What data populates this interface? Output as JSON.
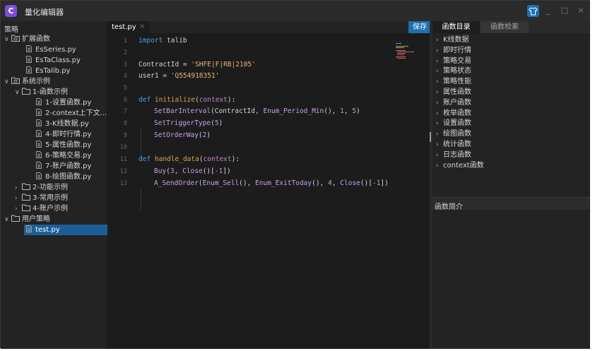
{
  "app": {
    "title": "量化编辑器",
    "logo_glyph": "C"
  },
  "strategy_panel": {
    "header": "策略",
    "tree": [
      {
        "label": "扩展函数",
        "kind": "folder-special",
        "expanded": true
      },
      {
        "label": "EsSeries.py",
        "kind": "file"
      },
      {
        "label": "EsTaClass.py",
        "kind": "file"
      },
      {
        "label": "EsTalib.py",
        "kind": "file"
      },
      {
        "label": "系统示例",
        "kind": "folder-special",
        "expanded": true
      },
      {
        "label": "1-函数示例",
        "kind": "folder",
        "expanded": true
      },
      {
        "label": "1-设置函数.py",
        "kind": "file"
      },
      {
        "label": "2-context上下文...",
        "kind": "file"
      },
      {
        "label": "3-K线数据.py",
        "kind": "file"
      },
      {
        "label": "4-即时行情.py",
        "kind": "file"
      },
      {
        "label": "5-属性函数.py",
        "kind": "file"
      },
      {
        "label": "6-策略交易.py",
        "kind": "file"
      },
      {
        "label": "7-账户函数.py",
        "kind": "file"
      },
      {
        "label": "8-绘图函数.py",
        "kind": "file"
      },
      {
        "label": "2-功能示例",
        "kind": "folder",
        "expanded": false
      },
      {
        "label": "3-常用示例",
        "kind": "folder",
        "expanded": false
      },
      {
        "label": "4-账户示例",
        "kind": "folder",
        "expanded": false
      },
      {
        "label": "用户策略",
        "kind": "folder",
        "expanded": true
      },
      {
        "label": "test.py",
        "kind": "file",
        "selected": true
      }
    ]
  },
  "editor": {
    "tab_label": "test.py",
    "tab_close": "×",
    "save_label": "保存",
    "line_numbers": [
      "1",
      "2",
      "3",
      "4",
      "5",
      "6",
      "7",
      "8",
      "9",
      "10",
      "11",
      "12",
      "13"
    ],
    "code": {
      "l1_kw": "import",
      "l1_rest": " talib",
      "l3_name": "ContractId = ",
      "l3_str": "'SHFE|F|RB|2105'",
      "l4_name": "user1 = ",
      "l4_str": "'Q554918351'",
      "l6_kw": "def",
      "l6_fn": "initialize",
      "l6_open": "(",
      "l6_param": "context",
      "l6_close": "):",
      "l7_fn": "SetBarInterval",
      "l7_a": "(ContractId, ",
      "l7_b": "Enum_Period_Min",
      "l7_c": "(), ",
      "l7_n1": "1",
      "l7_d": ", ",
      "l7_n2": "5",
      "l7_e": ")",
      "l8_fn": "SetTriggerType",
      "l8_a": "(",
      "l8_n": "5",
      "l8_b": ")",
      "l9_fn": "SetOrderWay",
      "l9_a": "(",
      "l9_n": "2",
      "l9_b": ")",
      "l11_kw": "def",
      "l11_fn": "handle_data",
      "l11_open": "(",
      "l11_param": "context",
      "l11_close": "):",
      "l12_fn": "Buy",
      "l12_a": "(",
      "l12_n": "3",
      "l12_b": ", ",
      "l12_c": "Close",
      "l12_d": "()[",
      "l12_e": "-1",
      "l12_f": "])",
      "l13_fn": "A_SendOrder",
      "l13_a": "(",
      "l13_b": "Enum_Sell",
      "l13_c": "(), ",
      "l13_d": "Enum_ExitToday",
      "l13_e": "(), ",
      "l13_n": "4",
      "l13_f": ", ",
      "l13_g": "Close",
      "l13_h": "()[",
      "l13_i": "-1",
      "l13_j": "])"
    }
  },
  "function_panel": {
    "tabs": [
      "函数目录",
      "函数检索"
    ],
    "items": [
      "K线数据",
      "即时行情",
      "策略交易",
      "策略状态",
      "策略性能",
      "属性函数",
      "账户函数",
      "枚举函数",
      "设置函数",
      "绘图函数",
      "统计函数",
      "日志函数",
      "context函数"
    ],
    "intro_label": "函数简介"
  },
  "colors": {
    "accent": "#1f6fb2",
    "logo": "#7b4ed8",
    "selection": "#1c5f96"
  }
}
